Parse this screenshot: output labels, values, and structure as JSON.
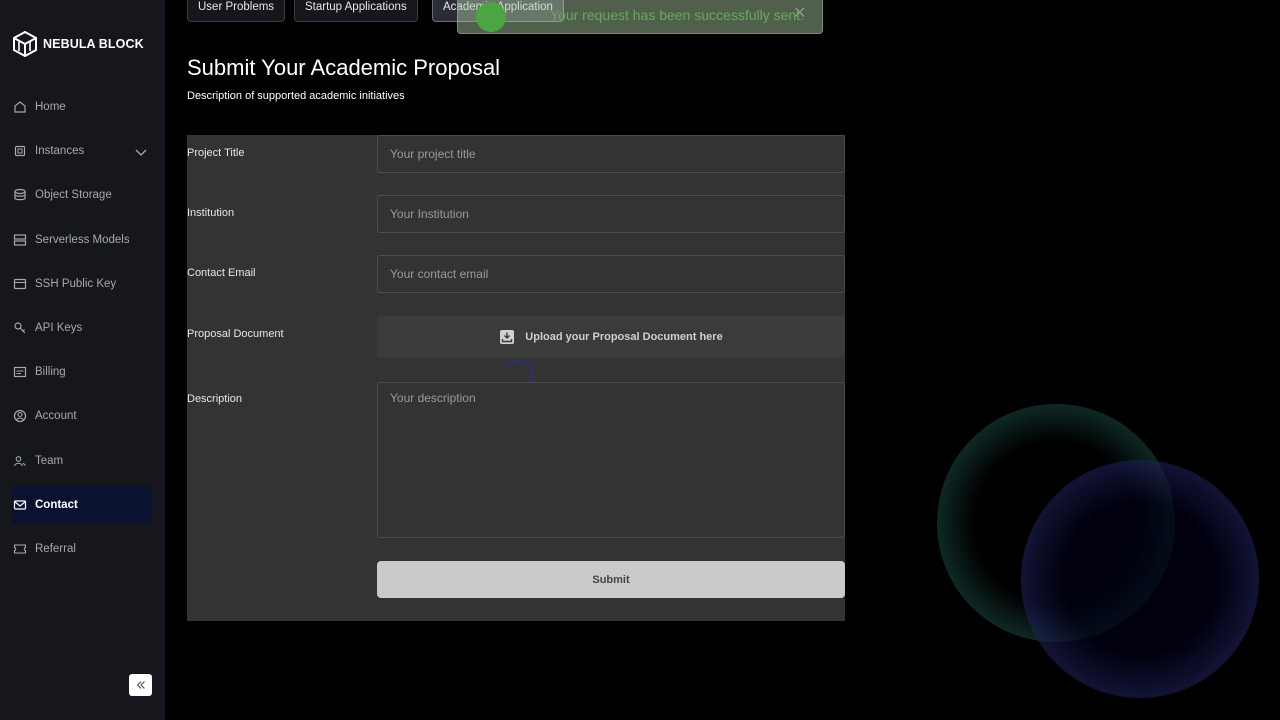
{
  "app": {
    "name": "NEBULA BLOCK"
  },
  "sidebar": {
    "items": [
      {
        "label": "Home",
        "icon": "home-icon"
      },
      {
        "label": "Instances",
        "icon": "chip-icon"
      },
      {
        "label": "Object Storage",
        "icon": "database-icon"
      },
      {
        "label": "Serverless Models",
        "icon": "server-icon"
      },
      {
        "label": "SSH Public Key",
        "icon": "key-card-icon"
      },
      {
        "label": "API Keys",
        "icon": "key-icon"
      },
      {
        "label": "Billing",
        "icon": "billing-icon"
      },
      {
        "label": "Account",
        "icon": "user-circle-icon"
      },
      {
        "label": "Team",
        "icon": "team-icon"
      },
      {
        "label": "Contact",
        "icon": "mail-icon"
      },
      {
        "label": "Referral",
        "icon": "ticket-icon"
      }
    ],
    "active": "Contact"
  },
  "tabs": [
    {
      "label": "User Problems"
    },
    {
      "label": "Startup Applications"
    },
    {
      "label": "Academia Application"
    }
  ],
  "toast": {
    "message": "Your request has been successfully sent."
  },
  "page": {
    "title": "Submit Your Academic Proposal",
    "subtitle": "Description of supported academic initiatives"
  },
  "form": {
    "project_title": {
      "label": "Project Title",
      "placeholder": "Your project title"
    },
    "institution": {
      "label": "Institution",
      "placeholder": "Your Institution"
    },
    "contact_email": {
      "label": "Contact Email",
      "placeholder": "Your contact email"
    },
    "proposal_document": {
      "label": "Proposal Document",
      "upload_text": "Upload your Proposal Document here"
    },
    "description": {
      "label": "Description",
      "placeholder": "Your description"
    },
    "submit_label": "Submit"
  },
  "colors": {
    "accent_active": "#0b1230",
    "toast_green": "#4aa542",
    "sidebar_bg": "#15171c"
  }
}
